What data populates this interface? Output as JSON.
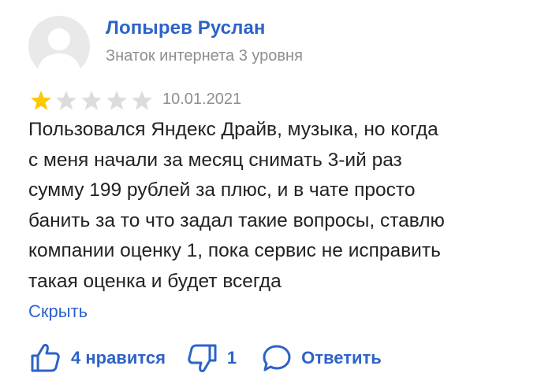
{
  "review": {
    "author": "Лопырев Руслан",
    "author_level": "Знаток интернета 3 уровня",
    "rating": 1,
    "rating_max": 5,
    "date": "10.01.2021",
    "text_lines": [
      "Пользовался Яндекс Драйв, музыка, но когда",
      "с меня начали за месяц снимать 3-ий раз",
      "сумму 199 рублей за плюс, и в чате просто",
      "банить за то что задал такие вопросы, ставлю",
      "компании оценку 1, пока сервис не исправить",
      "такая оценка и будет всегда"
    ],
    "hide_label": "Скрыть"
  },
  "actions": {
    "likes_label": "4 нравится",
    "dislikes_count": "1",
    "reply_label": "Ответить"
  },
  "colors": {
    "accent": "#2d63c8",
    "star_filled": "#fcc800",
    "star_empty": "#dcdcdc",
    "muted_text": "#8e8e8e"
  }
}
